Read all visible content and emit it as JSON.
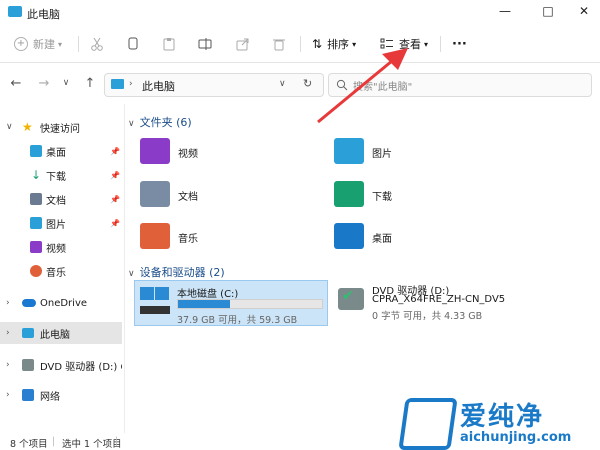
{
  "window": {
    "title": "此电脑",
    "minimize": "—",
    "maximize": "□",
    "close": "✕"
  },
  "toolbar": {
    "new_label": "新建",
    "sort_label": "排序",
    "view_label": "查看",
    "more_label": "···"
  },
  "address": {
    "crumb": "此电脑",
    "search_placeholder": "搜索\"此电脑\""
  },
  "sidebar": {
    "items": [
      {
        "label": "快速访问",
        "icon": "star-icon",
        "color": "#f0b400"
      },
      {
        "label": "桌面",
        "icon": "desktop-icon",
        "color": "#2a9fd8"
      },
      {
        "label": "下载",
        "icon": "download-icon",
        "color": "#18a070"
      },
      {
        "label": "文档",
        "icon": "document-icon",
        "color": "#6a7a90"
      },
      {
        "label": "图片",
        "icon": "picture-icon",
        "color": "#2a9fd8"
      },
      {
        "label": "视频",
        "icon": "video-icon",
        "color": "#8a3cc8"
      },
      {
        "label": "音乐",
        "icon": "music-icon",
        "color": "#e0603a"
      },
      {
        "label": "OneDrive",
        "icon": "cloud-icon",
        "color": "#1a78d0"
      },
      {
        "label": "此电脑",
        "icon": "pc-icon",
        "color": "#2a9fd8"
      },
      {
        "label": "DVD 驱动器 (D:) CF",
        "icon": "dvd-icon",
        "color": "#7a8a8a"
      },
      {
        "label": "网络",
        "icon": "network-icon",
        "color": "#2a7fd0"
      }
    ]
  },
  "content": {
    "folders_header": "文件夹 (6)",
    "folders": [
      {
        "name": "视频",
        "icon": "video-folder-icon",
        "color": "#8a3cc8"
      },
      {
        "name": "图片",
        "icon": "picture-folder-icon",
        "color": "#2a9fd8"
      },
      {
        "name": "文档",
        "icon": "document-folder-icon",
        "color": "#7a8ca4"
      },
      {
        "name": "下载",
        "icon": "download-folder-icon",
        "color": "#18a070"
      },
      {
        "name": "音乐",
        "icon": "music-folder-icon",
        "color": "#e0603a"
      },
      {
        "name": "桌面",
        "icon": "desktop-folder-icon",
        "color": "#1a78c8"
      }
    ],
    "drives_header": "设备和驱动器 (2)",
    "drives": [
      {
        "name": "本地磁盘 (C:)",
        "info": "37.9 GB 可用，共 59.3 GB",
        "used_fraction": 0.36
      },
      {
        "name": "DVD 驱动器 (D:)",
        "subname": "CPRA_X64FRE_ZH-CN_DV5",
        "info": "0 字节 可用，共 4.33 GB",
        "used_fraction": 1.0
      }
    ]
  },
  "status": {
    "count": "8 个项目",
    "selected": "选中 1 个项目"
  },
  "watermark": {
    "brand": "爱纯净",
    "url": "aichunjing.com"
  },
  "colors": {
    "accent": "#2a8ad4",
    "arrow": "#e8393a"
  }
}
